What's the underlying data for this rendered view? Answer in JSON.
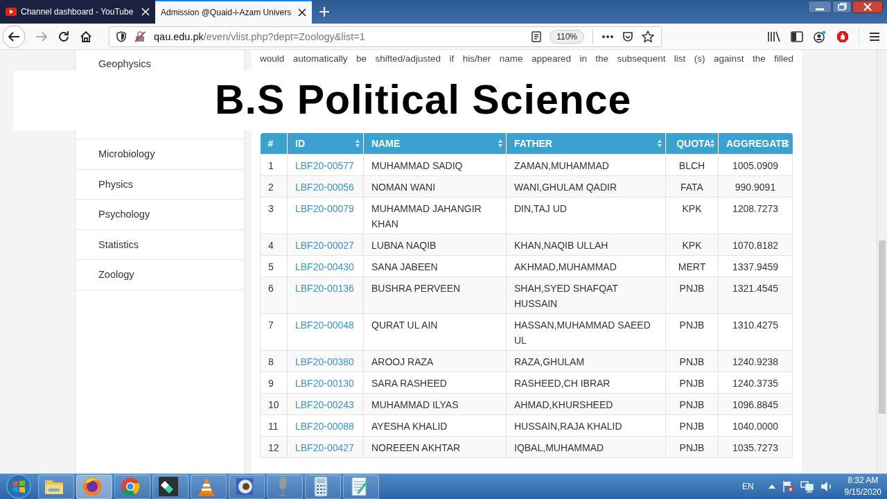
{
  "browser": {
    "tabs": [
      {
        "title": "Channel dashboard - YouTube",
        "selected": false
      },
      {
        "title": "Admission @Quaid-i-Azam Univers",
        "selected": true
      }
    ],
    "address": {
      "domain": "qau.edu.pk",
      "path": "/even/vlist.php?dept=Zoology&list=1"
    },
    "zoom": "110%"
  },
  "sidebar": {
    "items": [
      "Geophysics",
      "Microbiology",
      "Physics",
      "Psychology",
      "Statistics",
      "Zoology"
    ]
  },
  "notice": "would automatically be shifted/adjusted if his/her name appeared in the subsequent list (s) against the filled",
  "banner": "B.S Political Science",
  "table": {
    "columns": [
      {
        "label": "#",
        "sortable": false
      },
      {
        "label": "ID",
        "sortable": true
      },
      {
        "label": "NAME",
        "sortable": true
      },
      {
        "label": "FATHER",
        "sortable": true
      },
      {
        "label": "QUOTA",
        "sortable": true
      },
      {
        "label": "AGGREGATE",
        "sortable": true
      }
    ],
    "rows": [
      [
        "1",
        "LBF20-00577",
        "MUHAMMAD SADIQ",
        "ZAMAN,MUHAMMAD",
        "BLCH",
        "1005.0909"
      ],
      [
        "2",
        "LBF20-00056",
        "NOMAN WANI",
        "WANI,GHULAM QADIR",
        "FATA",
        "990.9091"
      ],
      [
        "3",
        "LBF20-00079",
        "MUHAMMAD JAHANGIR KHAN",
        "DIN,TAJ UD",
        "KPK",
        "1208.7273"
      ],
      [
        "4",
        "LBF20-00027",
        "LUBNA NAQIB",
        "KHAN,NAQIB ULLAH",
        "KPK",
        "1070.8182"
      ],
      [
        "5",
        "LBF20-00430",
        "SANA JABEEN",
        "AKHMAD,MUHAMMAD",
        "MERT",
        "1337.9459"
      ],
      [
        "6",
        "LBF20-00136",
        "BUSHRA PERVEEN",
        "SHAH,SYED SHAFQAT HUSSAIN",
        "PNJB",
        "1321.4545"
      ],
      [
        "7",
        "LBF20-00048",
        "QURAT UL AIN",
        "HASSAN,MUHAMMAD SAEED UL",
        "PNJB",
        "1310.4275"
      ],
      [
        "8",
        "LBF20-00380",
        "AROOJ RAZA",
        "RAZA,GHULAM",
        "PNJB",
        "1240.9238"
      ],
      [
        "9",
        "LBF20-00130",
        "SARA RASHEED",
        "RASHEED,CH IBRAR",
        "PNJB",
        "1240.3735"
      ],
      [
        "10",
        "LBF20-00243",
        "MUHAMMAD ILYAS",
        "AHMAD,KHURSHEED",
        "PNJB",
        "1096.8845"
      ],
      [
        "11",
        "LBF20-00088",
        "AYESHA KHALID",
        "HUSSAIN,RAJA KHALID",
        "PNJB",
        "1040.0000"
      ],
      [
        "12",
        "LBF20-00427",
        "NOREEEN AKHTAR",
        "IQBAL,MUHAMMAD",
        "PNJB",
        "1035.7273"
      ]
    ]
  },
  "taskbar": {
    "apps": [
      {
        "kind": "folder",
        "active": false
      },
      {
        "kind": "firefox",
        "active": true
      },
      {
        "kind": "chrome",
        "active": false
      },
      {
        "kind": "editor",
        "active": false
      },
      {
        "kind": "cone",
        "active": false
      },
      {
        "kind": "viewer",
        "active": false
      },
      {
        "kind": "microphone",
        "active": false
      },
      {
        "kind": "calculator",
        "active": false
      },
      {
        "kind": "notepad",
        "active": false
      }
    ],
    "language": "EN",
    "time": "8:32 AM",
    "date": "9/15/2020"
  }
}
